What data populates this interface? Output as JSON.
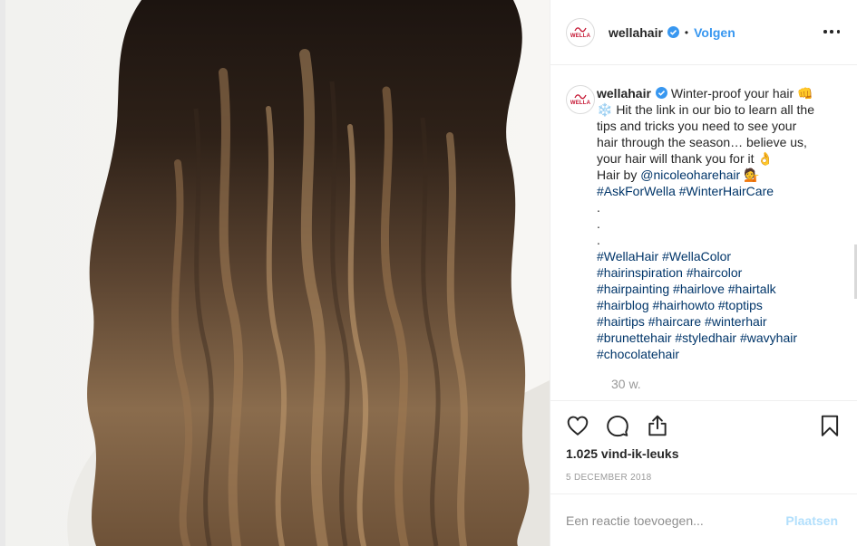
{
  "post": {
    "image_alt": "wavy brunette balayage hair",
    "header": {
      "username": "wellahair",
      "verified": true,
      "dot": "•",
      "follow_label": "Volgen",
      "more_icon": "more-options-icon"
    },
    "avatar": {
      "text": "WELLA",
      "brand_color": "#c4122f"
    },
    "caption": {
      "username": "wellahair",
      "lines": [
        "Winter-proof your hair 👊",
        "❄️ Hit the link in our bio to learn all the",
        "tips and tricks you need to see your",
        "hair through the season… believe us,",
        "your hair will thank you for it 👌"
      ],
      "credit_prefix": "Hair by ",
      "credit_handle": "@nicoleoharehair",
      "credit_emoji": "💁",
      "tag_line_1": "#AskForWella #WinterHairCare",
      "dots": [
        ".",
        ".",
        "."
      ],
      "hashtag_lines": [
        "#WellaHair #WellaColor",
        "#hairinspiration #haircolor",
        "#hairpainting #hairlove #hairtalk",
        "#hairblog #hairhowto #toptips",
        "#hairtips #haircare #winterhair",
        "#brunettehair #styledhair #wavyhair",
        "#chocolatehair"
      ],
      "time": "30 w."
    },
    "actions": {
      "like_icon": "heart-icon",
      "comment_icon": "comment-bubble-icon",
      "share_icon": "share-icon",
      "save_icon": "bookmark-icon"
    },
    "likes": "1.025 vind-ik-leuks",
    "date": "5 DECEMBER 2018",
    "comment": {
      "placeholder": "Een reactie toevoegen...",
      "post_label": "Plaatsen"
    },
    "colors": {
      "link": "#003569",
      "follow": "#3897f0",
      "post_disabled": "#b2dffc",
      "muted": "#999999"
    }
  }
}
